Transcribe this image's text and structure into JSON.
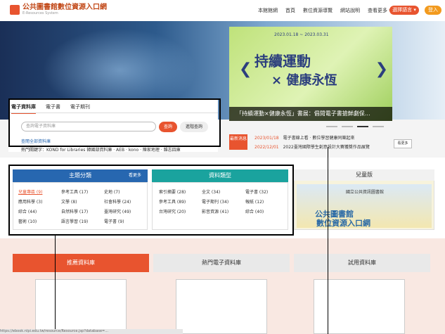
{
  "header": {
    "title": "公共圖書館數位資源入口網",
    "subtitle": "E-Resources System",
    "nav": [
      "本館館網",
      "首頁",
      "數位資源導覽",
      "網站說明",
      "查看更多 ▾"
    ],
    "language_label": "選擇語言 ▾",
    "login_label": "登入"
  },
  "banner": {
    "date": "2023.01.18 ~ 2023.03.31",
    "title_line1": "持續運動",
    "title_line2": "× 健康永恆",
    "caption": "「持續運動×健康永恆」書展：倡閱電子書搶鮮劇保…"
  },
  "search": {
    "tabs": [
      "電子資料庫",
      "電子書",
      "電子期刊"
    ],
    "placeholder": "查詢電子資料庫",
    "button": "查詢",
    "advanced": "進階查詢",
    "use_link": "查閱全部資料庫",
    "hot_keywords": "熱門關鍵字：KOND for Libraries  韓國部資料庫 · AEB · kono · 陳家地理 · 雜志四庫"
  },
  "news": {
    "label": "最新消息",
    "items": [
      {
        "date": "2023/01/18",
        "text": "電子書線上看 · 數位學習健康同樂起來"
      },
      {
        "date": "2022/12/01",
        "text": "2022臺灣國際學生創意設計大賽獲獎作品展覽"
      }
    ],
    "more": "看更多"
  },
  "subject": {
    "title": "主題分類",
    "more": "看更多",
    "cells": [
      "兒童專區 (9)",
      "參考工具 (17)",
      "史地 (7)",
      "應用科學 (3)",
      "文學 (8)",
      "社會科學 (24)",
      "綜合 (44)",
      "自然科學 (17)",
      "臺灣研究 (49)",
      "藝術 (10)",
      "語言學習 (19)",
      "電子書 (9)"
    ]
  },
  "types": {
    "title": "資料類型",
    "cells": [
      "索引摘要 (28)",
      "全文 (34)",
      "電子書 (32)",
      "參考工具 (89)",
      "電子期刊 (34)",
      "報紙 (12)",
      "台灣研究 (20)",
      "影音資源 (41)",
      "綜合 (40)"
    ]
  },
  "kids": {
    "title": "兒童版",
    "subtitle": "國立公共資訊圖書館",
    "line1": "公共圖書館",
    "line2": "數位資源入口網"
  },
  "bottom_tabs": [
    "推薦資料庫",
    "熱門電子資料庫",
    "試用資料庫"
  ],
  "status_url": "https://ebook.nlpi.edu.tw/resource/Resource.jsp?database=..."
}
